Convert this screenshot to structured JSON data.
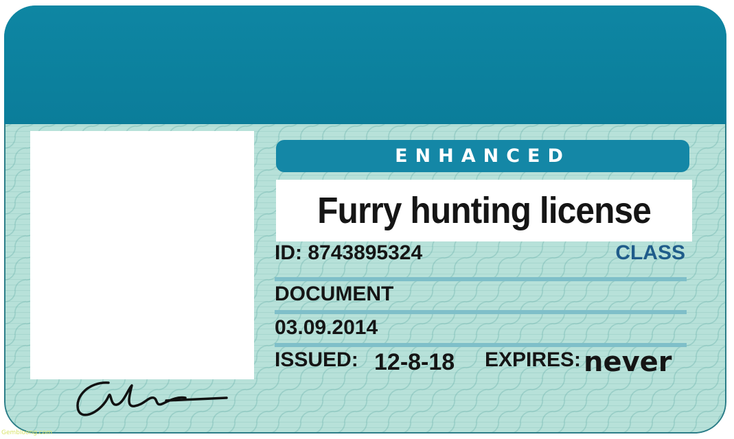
{
  "card": {
    "enhanced_label": "ENHANCED",
    "title": "Furry hunting license",
    "id_label": "ID: 8743895324",
    "class_label": "CLASS",
    "document_label": "DOCUMENT",
    "document_date": "03.09.2014",
    "issued_label": "ISSUED:",
    "issued_value": "12-8-18",
    "expires_label": "EXPIRES:",
    "expires_value": "never",
    "signature_text": "Oln"
  },
  "watermark": "Gembloong.com",
  "colors": {
    "header": "#0b7d9a",
    "card_body": "#b7e1d9",
    "enhanced_bar": "#1487a6",
    "class_text": "#1f5c8a"
  }
}
